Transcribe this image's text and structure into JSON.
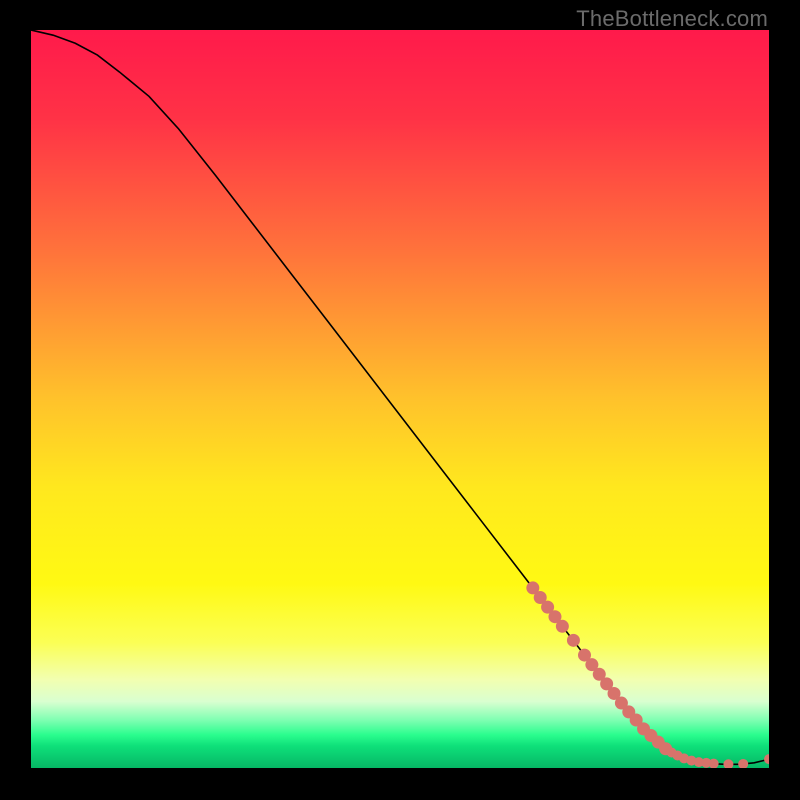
{
  "watermark": "TheBottleneck.com",
  "chart_data": {
    "type": "line",
    "title": "",
    "xlabel": "",
    "ylabel": "",
    "xlim": [
      0,
      100
    ],
    "ylim": [
      0,
      100
    ],
    "grid": false,
    "legend": false,
    "background_gradient": {
      "stops": [
        {
          "pos": 0.0,
          "color": "#ff1a4b"
        },
        {
          "pos": 0.12,
          "color": "#ff3246"
        },
        {
          "pos": 0.3,
          "color": "#ff733b"
        },
        {
          "pos": 0.5,
          "color": "#ffc22b"
        },
        {
          "pos": 0.62,
          "color": "#ffe81e"
        },
        {
          "pos": 0.75,
          "color": "#fff913"
        },
        {
          "pos": 0.83,
          "color": "#fbff55"
        },
        {
          "pos": 0.88,
          "color": "#f2ffb0"
        },
        {
          "pos": 0.91,
          "color": "#d9ffd0"
        },
        {
          "pos": 0.935,
          "color": "#7fffb2"
        },
        {
          "pos": 0.955,
          "color": "#2bfd8e"
        },
        {
          "pos": 0.97,
          "color": "#0ee07a"
        },
        {
          "pos": 1.0,
          "color": "#06b765"
        }
      ]
    },
    "series": [
      {
        "name": "curve",
        "color": "#000000",
        "x": [
          0,
          3,
          6,
          9,
          12,
          16,
          20,
          25,
          30,
          35,
          40,
          45,
          50,
          55,
          60,
          65,
          70,
          75,
          80,
          83,
          86,
          88,
          90,
          92,
          94,
          96,
          98,
          100
        ],
        "y": [
          100,
          99.3,
          98.2,
          96.6,
          94.3,
          91.0,
          86.6,
          80.3,
          73.8,
          67.3,
          60.8,
          54.3,
          47.8,
          41.3,
          34.8,
          28.3,
          21.8,
          15.3,
          8.8,
          5.3,
          2.6,
          1.5,
          0.9,
          0.6,
          0.5,
          0.5,
          0.7,
          1.2
        ]
      }
    ],
    "markers": {
      "name": "highlight-dots",
      "color": "#d8736b",
      "radius_main": 6.5,
      "radius_tail": 5.0,
      "points": [
        {
          "x": 68.0,
          "y": 24.4,
          "r": 6.5
        },
        {
          "x": 69.0,
          "y": 23.1,
          "r": 6.5
        },
        {
          "x": 70.0,
          "y": 21.8,
          "r": 6.5
        },
        {
          "x": 71.0,
          "y": 20.5,
          "r": 6.5
        },
        {
          "x": 72.0,
          "y": 19.2,
          "r": 6.5
        },
        {
          "x": 73.5,
          "y": 17.3,
          "r": 6.5
        },
        {
          "x": 75.0,
          "y": 15.3,
          "r": 6.5
        },
        {
          "x": 76.0,
          "y": 14.0,
          "r": 6.5
        },
        {
          "x": 77.0,
          "y": 12.7,
          "r": 6.5
        },
        {
          "x": 78.0,
          "y": 11.4,
          "r": 6.5
        },
        {
          "x": 79.0,
          "y": 10.1,
          "r": 6.5
        },
        {
          "x": 80.0,
          "y": 8.8,
          "r": 6.5
        },
        {
          "x": 81.0,
          "y": 7.6,
          "r": 6.5
        },
        {
          "x": 82.0,
          "y": 6.5,
          "r": 6.5
        },
        {
          "x": 83.0,
          "y": 5.3,
          "r": 6.5
        },
        {
          "x": 84.0,
          "y": 4.4,
          "r": 6.5
        },
        {
          "x": 85.0,
          "y": 3.5,
          "r": 6.5
        },
        {
          "x": 86.0,
          "y": 2.6,
          "r": 6.5
        },
        {
          "x": 86.8,
          "y": 2.1,
          "r": 5.0
        },
        {
          "x": 87.6,
          "y": 1.7,
          "r": 5.0
        },
        {
          "x": 88.5,
          "y": 1.3,
          "r": 5.0
        },
        {
          "x": 89.5,
          "y": 1.0,
          "r": 5.0
        },
        {
          "x": 90.5,
          "y": 0.8,
          "r": 5.0
        },
        {
          "x": 91.5,
          "y": 0.7,
          "r": 5.0
        },
        {
          "x": 92.5,
          "y": 0.6,
          "r": 5.0
        },
        {
          "x": 94.5,
          "y": 0.5,
          "r": 5.0
        },
        {
          "x": 96.5,
          "y": 0.55,
          "r": 5.0
        },
        {
          "x": 100.0,
          "y": 1.2,
          "r": 5.0
        }
      ]
    }
  }
}
